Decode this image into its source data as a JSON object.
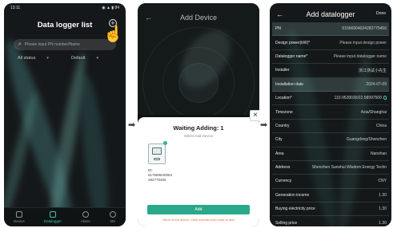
{
  "screen1": {
    "status_time": "13:11",
    "status_icons": "◉ ▲ ▮ 84",
    "title": "Data logger list",
    "search_placeholder": "Please input PN number/Name",
    "filter_status": "All status",
    "filter_sort": "Default",
    "tabs": [
      {
        "label": "Device",
        "icon": "device-icon"
      },
      {
        "label": "Datalogger",
        "icon": "datalogger-icon",
        "active": true
      },
      {
        "label": "Alarm",
        "icon": "alarm-icon"
      },
      {
        "label": "Me",
        "icon": "user-icon"
      }
    ]
  },
  "screen2": {
    "title": "Add Device",
    "sheet_title": "Waiting Adding: 1",
    "sheet_subtitle": "Select Add Device",
    "device_sn_label": "ID:",
    "device_sn_line1": "617669640054",
    "device_sn_line2": "282775456",
    "add_button": "Add",
    "hint": "None of the above. Click manual scan code to add"
  },
  "screen3": {
    "title": "Add datalogger",
    "done_label": "Done",
    "rows": [
      {
        "label": "PN",
        "value": "61566904024282775456"
      },
      {
        "label": "Design power(kW)*",
        "value": "Please input design power"
      },
      {
        "label": "Datalogger name*",
        "value": "Please input datalogger name"
      },
      {
        "label": "Installer",
        "value": "浙江测试小先生"
      },
      {
        "label": "Installation date",
        "value": "2024-07-09"
      },
      {
        "label": "Location*",
        "value": "110.9528030/22.58997500"
      },
      {
        "label": "Timezone",
        "value": "Asia/Shanghai"
      },
      {
        "label": "Country",
        "value": "China"
      },
      {
        "label": "City",
        "value": "Guangdong/Shenzhen"
      },
      {
        "label": "Area",
        "value": "Nanshan"
      },
      {
        "label": "Address",
        "value": "Shenzhen Sanshui Wisdom Energy Techn"
      },
      {
        "label": "Currency",
        "value": "CNY"
      },
      {
        "label": "Generation income",
        "value": "1.30"
      },
      {
        "label": "Buying electricity price",
        "value": "1.30"
      },
      {
        "label": "Selling price",
        "value": "1.30"
      }
    ]
  },
  "colors": {
    "accent": "#2aa88a",
    "background_dark": "#15181a",
    "hint": "#e0693a"
  }
}
